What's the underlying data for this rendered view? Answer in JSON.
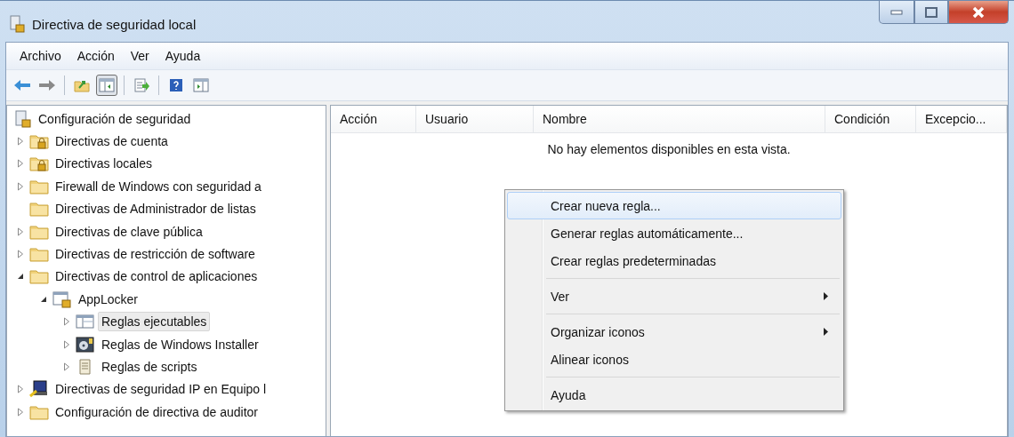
{
  "window": {
    "title": "Directiva de seguridad local"
  },
  "menu_bar": [
    {
      "label": "Archivo"
    },
    {
      "label": "Acción"
    },
    {
      "label": "Ver"
    },
    {
      "label": "Ayuda"
    }
  ],
  "toolbar": [
    {
      "kind": "back",
      "pressed": false
    },
    {
      "kind": "forward",
      "pressed": false
    },
    {
      "kind": "separator"
    },
    {
      "kind": "up",
      "pressed": false
    },
    {
      "kind": "tree",
      "pressed": true
    },
    {
      "kind": "separator"
    },
    {
      "kind": "export",
      "pressed": false
    },
    {
      "kind": "separator"
    },
    {
      "kind": "help",
      "pressed": false
    },
    {
      "kind": "pane",
      "pressed": false
    }
  ],
  "tree": [
    {
      "label": "Configuración de seguridad",
      "kind": "root",
      "selected": false,
      "children": [
        {
          "label": "Directivas de cuenta",
          "kind": "lockfolder",
          "expandable": true,
          "expanded": false,
          "selected": false
        },
        {
          "label": "Directivas locales",
          "kind": "lockfolder",
          "expandable": true,
          "expanded": false,
          "selected": false
        },
        {
          "label": "Firewall de Windows con seguridad a",
          "kind": "folder",
          "expandable": true,
          "expanded": false,
          "selected": false
        },
        {
          "label": "Directivas de Administrador de listas",
          "kind": "folder",
          "selected": false
        },
        {
          "label": "Directivas de clave pública",
          "kind": "folder",
          "expandable": true,
          "expanded": false,
          "selected": false
        },
        {
          "label": "Directivas de restricción de software",
          "kind": "folder",
          "expandable": true,
          "expanded": false,
          "selected": false
        },
        {
          "label": "Directivas de control de aplicaciones",
          "kind": "folder",
          "expandable": true,
          "expanded": true,
          "selected": false,
          "children": [
            {
              "label": "AppLocker",
              "kind": "applocker",
              "expandable": true,
              "expanded": true,
              "selected": false,
              "children": [
                {
                  "label": "Reglas ejecutables",
                  "kind": "rules",
                  "expandable": true,
                  "expanded": false,
                  "selected": true
                },
                {
                  "label": "Reglas de Windows Installer",
                  "kind": "installer",
                  "expandable": true,
                  "expanded": false,
                  "selected": false
                },
                {
                  "label": "Reglas de scripts",
                  "kind": "scripts",
                  "expandable": true,
                  "expanded": false,
                  "selected": false
                }
              ]
            }
          ]
        },
        {
          "label": "Directivas de seguridad IP en Equipo l",
          "kind": "computer",
          "expandable": true,
          "expanded": false,
          "selected": false
        },
        {
          "label": "Configuración de directiva de auditor",
          "kind": "folder",
          "expandable": true,
          "expanded": false,
          "selected": false
        }
      ]
    }
  ],
  "table": {
    "columns": [
      "Acción",
      "Usuario",
      "Nombre",
      "Condición",
      "Excepcio..."
    ],
    "empty_message": "No hay elementos disponibles en esta vista."
  },
  "context_menu": [
    {
      "kind": "item",
      "label": "Crear nueva regla...",
      "selected": true,
      "submenu": false
    },
    {
      "kind": "item",
      "label": "Generar reglas automáticamente...",
      "selected": false,
      "submenu": false
    },
    {
      "kind": "item",
      "label": "Crear reglas predeterminadas",
      "selected": false,
      "submenu": false
    },
    {
      "kind": "separator"
    },
    {
      "kind": "item",
      "label": "Ver",
      "selected": false,
      "submenu": true
    },
    {
      "kind": "separator"
    },
    {
      "kind": "item",
      "label": "Organizar iconos",
      "selected": false,
      "submenu": true
    },
    {
      "kind": "item",
      "label": "Alinear iconos",
      "selected": false,
      "submenu": false
    },
    {
      "kind": "separator"
    },
    {
      "kind": "item",
      "label": "Ayuda",
      "selected": false,
      "submenu": false
    }
  ]
}
